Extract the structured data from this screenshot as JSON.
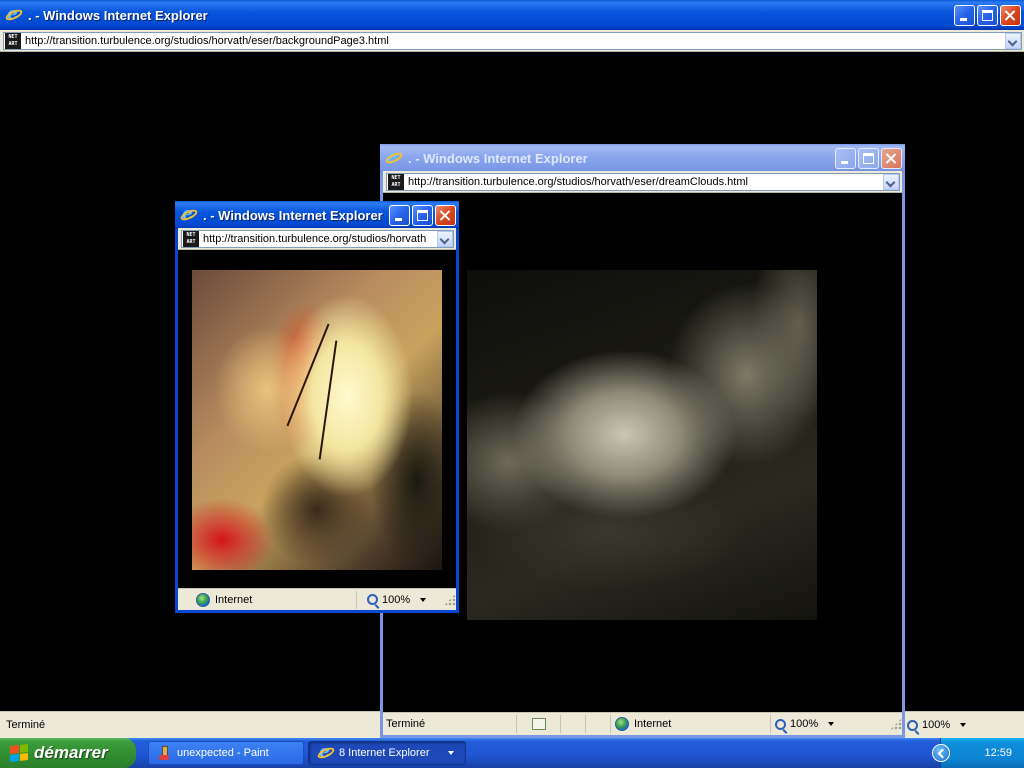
{
  "windows": {
    "background": {
      "title": ". - Windows Internet Explorer",
      "url": "http://transition.turbulence.org/studios/horvath/eser/backgroundPage3.html",
      "status_text": "Terminé",
      "zoom": "100%"
    },
    "clouds": {
      "title": ". - Windows Internet Explorer",
      "url": "http://transition.turbulence.org/studios/horvath/eser/dreamClouds.html",
      "status_text": "Terminé",
      "zone": "Internet",
      "zoom": "100%"
    },
    "fire": {
      "title": ". - Windows Internet Explorer",
      "url": "http://transition.turbulence.org/studios/horvath",
      "zone": "Internet",
      "zoom": "100%"
    }
  },
  "site_icon_text": "NET ART",
  "taskbar": {
    "start_label": "démarrer",
    "tasks": [
      {
        "label": "unexpected - Paint"
      },
      {
        "label": "8 Internet Explorer"
      }
    ],
    "clock": "12:59"
  },
  "icons": {
    "browser": "ie-icon",
    "site": "net-art-icon",
    "zone": "globe-icon",
    "zoom": "magnifier-icon",
    "start": "windows-flag-icon",
    "paint": "paint-icon",
    "tray_expand": "chevron-left-icon"
  }
}
